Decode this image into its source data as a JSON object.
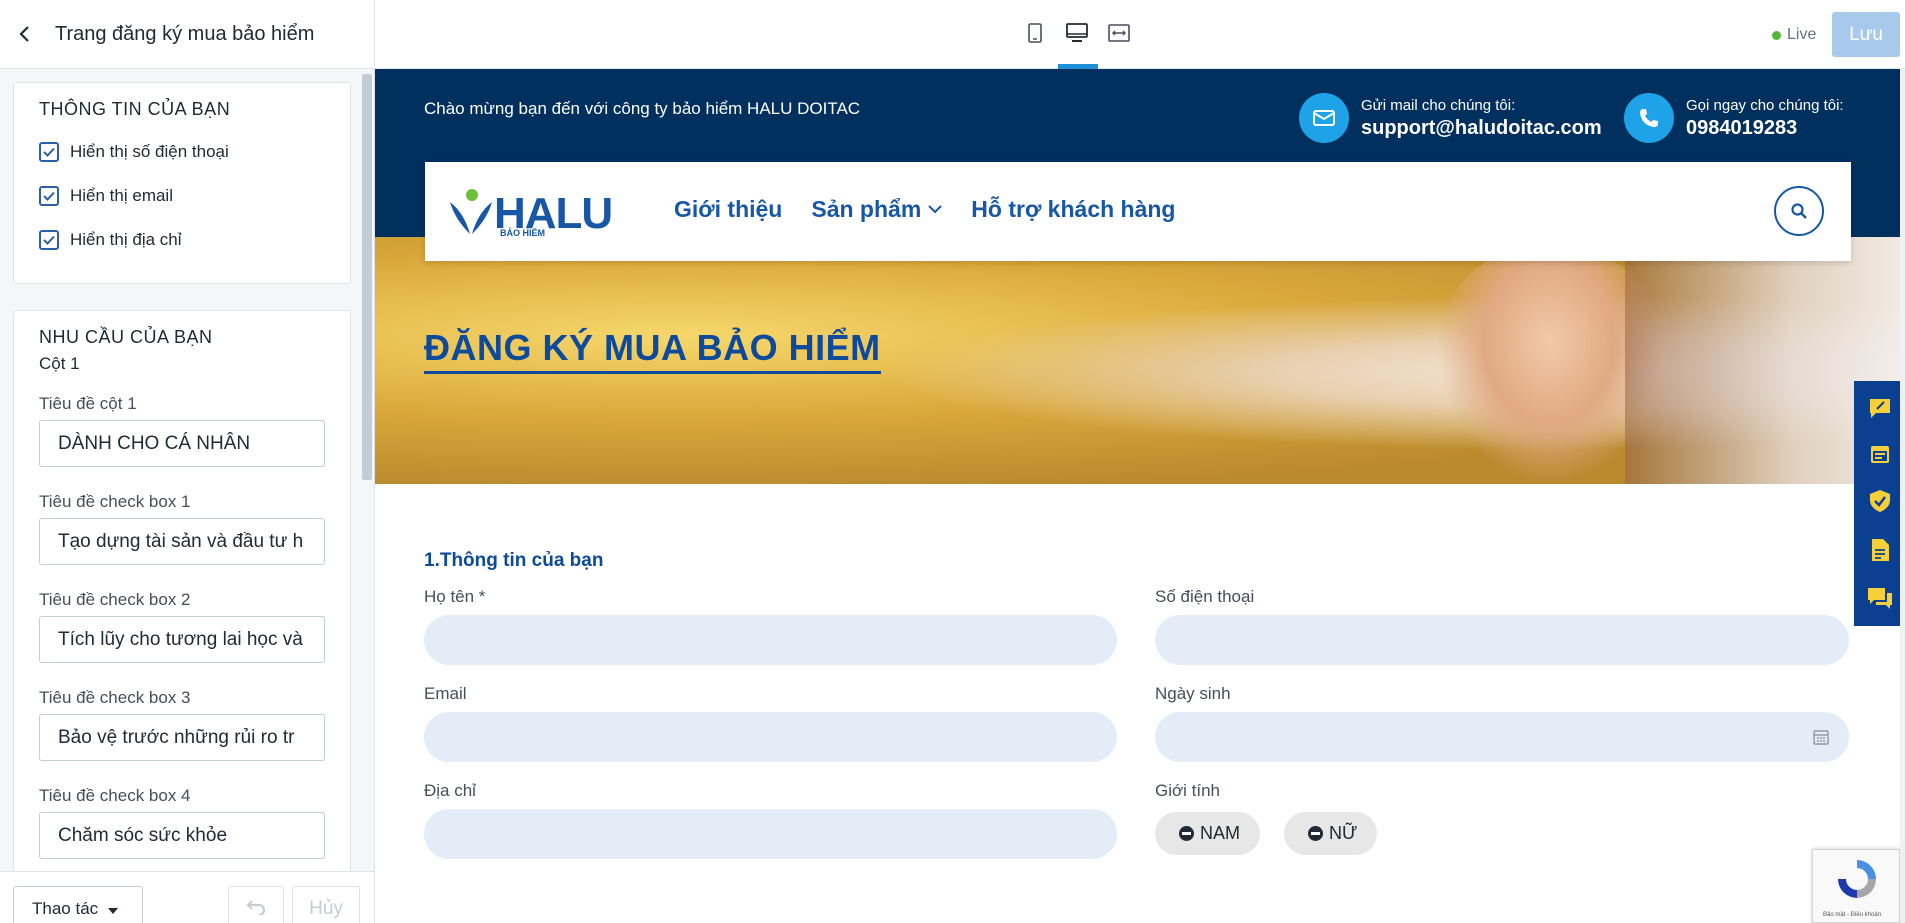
{
  "editor": {
    "title": "Trang đăng ký mua bảo hiểm",
    "card1": {
      "heading": "THÔNG TIN CỦA BẠN",
      "checks": [
        "Hiển thị số điện thoại",
        "Hiển thị email",
        "Hiển thị địa chỉ"
      ]
    },
    "card2": {
      "heading": "NHU CẦU CỦA BẠN",
      "sub": "Cột 1",
      "fields": [
        {
          "label": "Tiêu đề cột 1",
          "value": "DÀNH CHO CÁ NHÂN"
        },
        {
          "label": "Tiêu đề check box 1",
          "value": "Tạo dựng tài sản và đầu tư h"
        },
        {
          "label": "Tiêu đề check box 2",
          "value": "Tích lũy cho tương lai học và"
        },
        {
          "label": "Tiêu đề check box 3",
          "value": "Bảo vệ trước những rủi ro tr"
        },
        {
          "label": "Tiêu đề check box 4",
          "value": "Chăm sóc sức khỏe"
        }
      ]
    },
    "footer": {
      "actions": "Thao tác",
      "cancel": "Hủy"
    }
  },
  "topbar": {
    "live": "Live",
    "save": "Lưu"
  },
  "site": {
    "welcome": "Chào mừng bạn đến với công ty bảo hiểm HALU DOITAC",
    "mail_label": "Gửi mail cho chúng tôi:",
    "mail": "support@haludoitac.com",
    "phone_label": "Gọi ngay cho chúng tôi:",
    "phone": "0984019283",
    "logo": "HALU",
    "logo_tag": "BẢO HIỂM",
    "nav": [
      "Giới thiệu",
      "Sản phẩm",
      "Hỗ trợ khách hàng"
    ],
    "hero_title": "ĐĂNG KÝ MUA BẢO HIỂM",
    "form_title": "1.Thông tin của bạn",
    "labels": {
      "name": "Họ tên *",
      "phone": "Số điện thoại",
      "email": "Email",
      "dob": "Ngày sinh",
      "address": "Địa chỉ",
      "gender": "Giới tính"
    },
    "gender_options": [
      "NAM",
      "NỮ"
    ],
    "recaptcha_text": "Bảo mật - Điều khoản"
  },
  "colors": {
    "brand": "#1757a6",
    "dark_navy": "#01305e",
    "accent": "#1fa3e8"
  }
}
